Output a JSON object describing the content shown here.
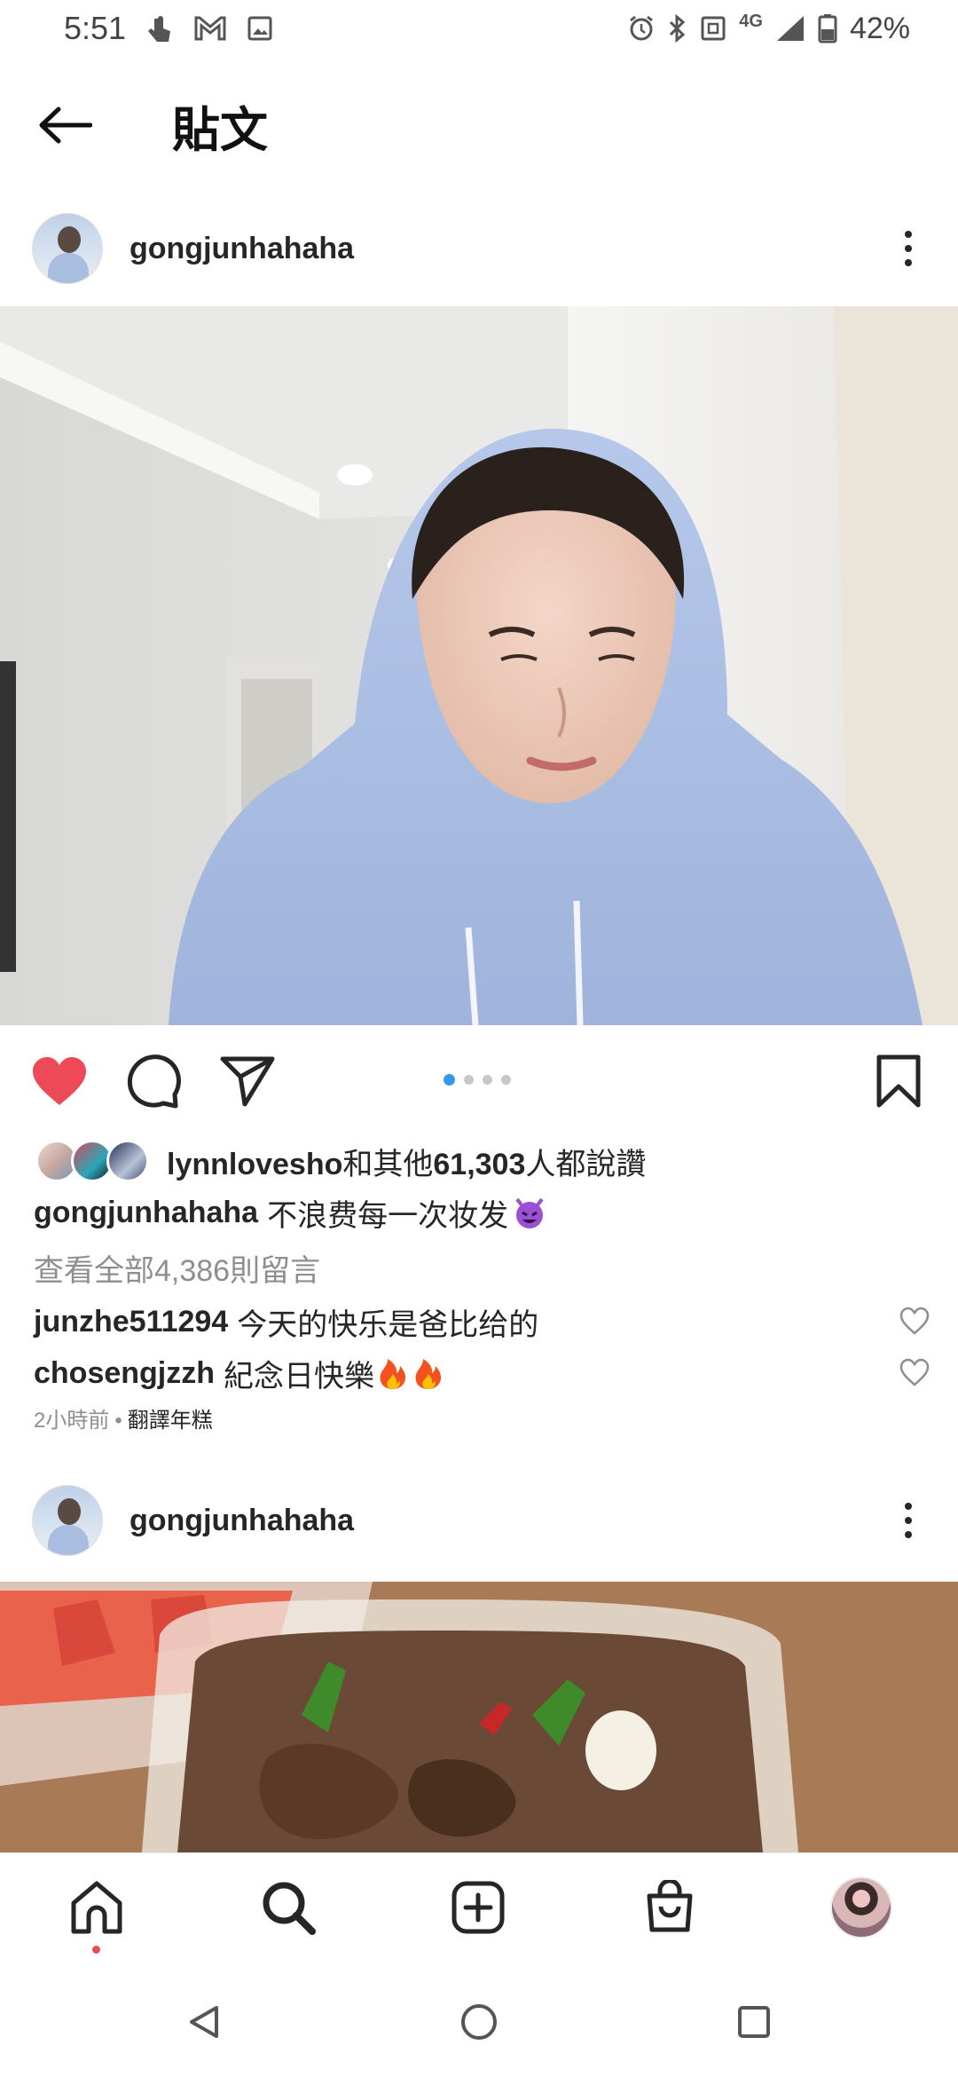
{
  "status_bar": {
    "time": "5:51",
    "network": "4G",
    "battery": "42%"
  },
  "header": {
    "title": "貼文"
  },
  "post1": {
    "username": "gongjunhahaha",
    "image_alt": "man in light blue hoodie",
    "carousel": {
      "count": 4,
      "active_index": 0
    },
    "likes": {
      "user": "lynnlovesho",
      "middle": "和其他",
      "count": "61,303",
      "suffix": "人都說讚"
    },
    "caption": {
      "user": "gongjunhahaha",
      "text": "不浪费每一次妆发"
    },
    "view_all_comments": "查看全部4,386則留言",
    "comments": [
      {
        "user": "junzhe511294",
        "text": "今天的快乐是爸比给的"
      },
      {
        "user": "chosengjzzh",
        "text": "紀念日快樂"
      }
    ],
    "time_ago": "2小時前",
    "separator": "•",
    "translate": "翻譯年糕"
  },
  "post2": {
    "username": "gongjunhahaha"
  },
  "colors": {
    "like_red": "#ed4956",
    "carousel_active": "#3897f0",
    "text_primary": "#262626",
    "text_secondary": "#8e8e8e"
  },
  "icons": {
    "back": "arrow-left-icon",
    "more": "more-vertical-icon",
    "like": "heart-filled-icon",
    "comment": "comment-bubble-icon",
    "share": "paper-plane-icon",
    "save": "bookmark-icon",
    "nav": [
      "home-icon",
      "search-icon",
      "add-post-icon",
      "shop-icon",
      "profile-avatar"
    ]
  }
}
